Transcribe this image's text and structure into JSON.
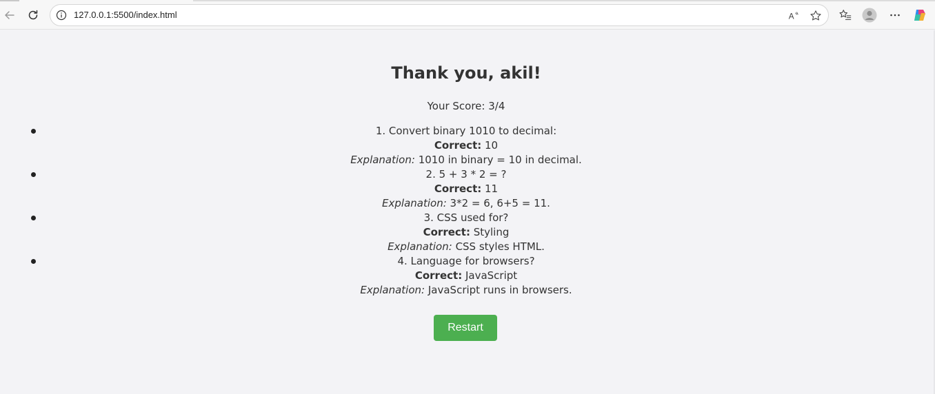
{
  "browser": {
    "url": "127.0.0.1:5500/index.html"
  },
  "page": {
    "title": "Thank you, akil!",
    "score": "Your Score: 3/4",
    "results": [
      {
        "question": "1. Convert binary 1010 to decimal:",
        "correct_label": "Correct:",
        "correct_value": " 10",
        "explanation_label": "Explanation:",
        "explanation_value": " 1010 in binary = 10 in decimal."
      },
      {
        "question": "2. 5 + 3 * 2 = ?",
        "correct_label": "Correct:",
        "correct_value": " 11",
        "explanation_label": "Explanation:",
        "explanation_value": " 3*2 = 6, 6+5 = 11."
      },
      {
        "question": "3. CSS used for?",
        "correct_label": "Correct:",
        "correct_value": " Styling",
        "explanation_label": "Explanation:",
        "explanation_value": " CSS styles HTML."
      },
      {
        "question": "4. Language for browsers?",
        "correct_label": "Correct:",
        "correct_value": " JavaScript",
        "explanation_label": "Explanation:",
        "explanation_value": " JavaScript runs in browsers."
      }
    ],
    "restart_label": "Restart"
  },
  "colors": {
    "button": "#4caf50",
    "background": "#f3f3f6",
    "text": "#333333"
  }
}
